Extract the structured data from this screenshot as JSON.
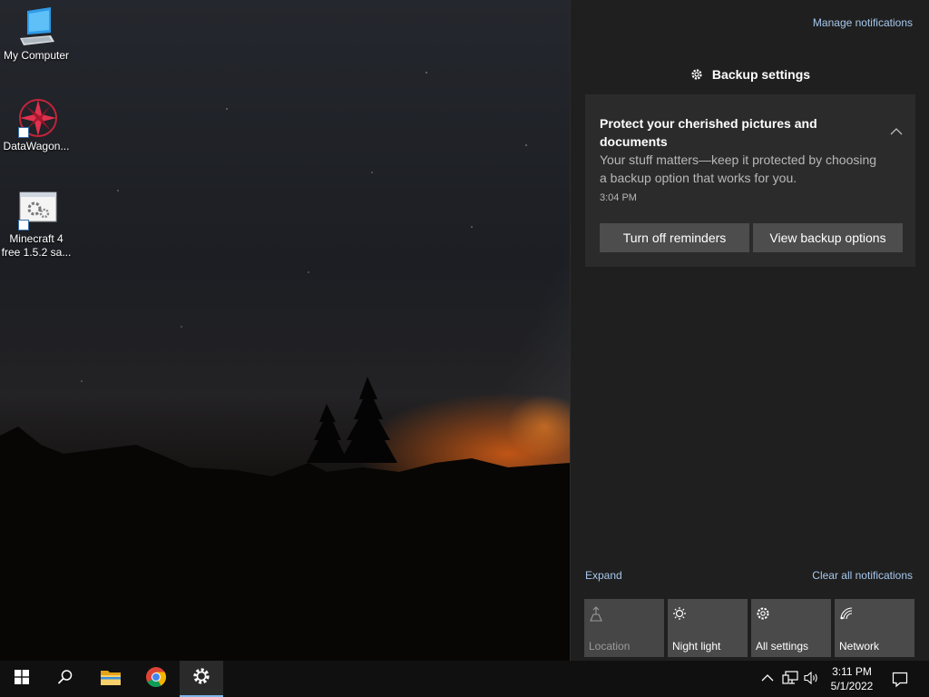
{
  "desktop": {
    "icons": [
      {
        "label": "My Computer",
        "icon": "computer-icon"
      },
      {
        "label": "DataWagon...",
        "icon": "datawagon-icon"
      },
      {
        "label_line1": "Minecraft 4",
        "label_line2": "free 1.5.2 sa...",
        "icon": "settings-gears-icon"
      }
    ]
  },
  "action_center": {
    "manage_notifications": "Manage notifications",
    "group_title": "Backup settings",
    "notification": {
      "title": "Protect your cherished pictures and documents",
      "body": "Your stuff matters—keep it protected by choosing a backup option that works for you.",
      "time": "3:04 PM",
      "button_primary": "Turn off reminders",
      "button_secondary": "View backup options"
    },
    "expand": "Expand",
    "clear_all": "Clear all notifications",
    "quick_actions": [
      {
        "label": "Location",
        "icon": "location-icon",
        "enabled": false
      },
      {
        "label": "Night light",
        "icon": "night-light-icon",
        "enabled": true
      },
      {
        "label": "All settings",
        "icon": "gear-icon",
        "enabled": true
      },
      {
        "label": "Network",
        "icon": "network-icon",
        "enabled": true
      }
    ]
  },
  "taskbar": {
    "apps": [
      "start-icon",
      "search-icon",
      "file-explorer-icon",
      "chrome-icon",
      "settings-icon"
    ],
    "active_app": "settings-icon",
    "clock_time": "3:11 PM",
    "clock_date": "5/1/2022"
  },
  "colors": {
    "accent_link": "#a6c8ee",
    "panel_bg": "#1f1f1f",
    "toast_bg": "#2b2b2b",
    "button_bg": "#4d4d4d",
    "active_underline": "#7fb4e8"
  }
}
